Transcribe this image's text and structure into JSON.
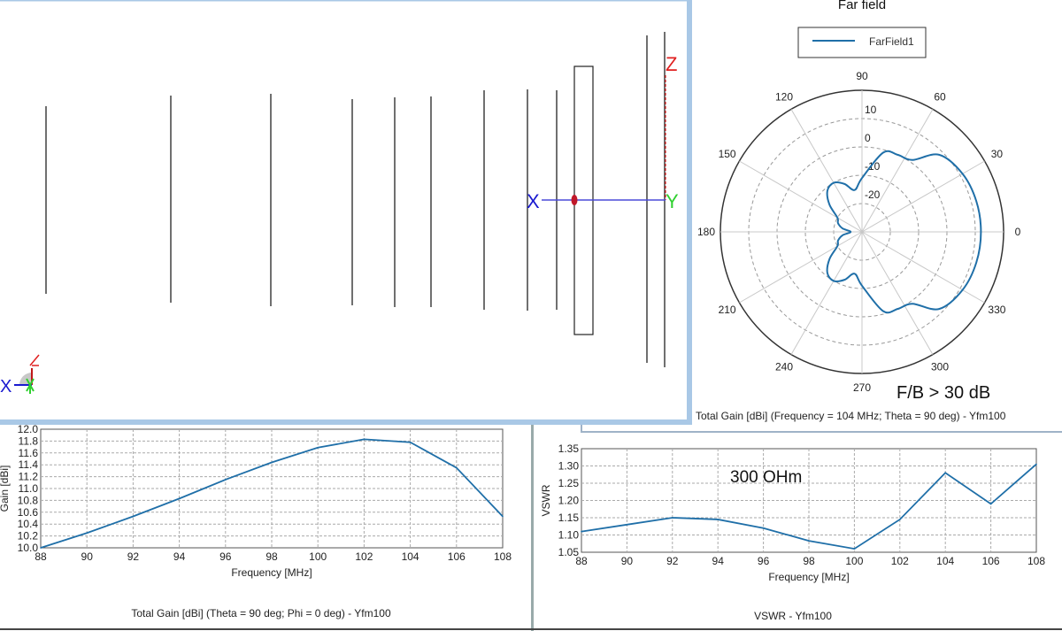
{
  "view3d": {
    "axis_labels": {
      "x": "X",
      "y": "Y",
      "z": "Z"
    },
    "triad_labels": {
      "x": "X"
    }
  },
  "colors": {
    "series": "#1f6fa8",
    "x_axis": "#1a1ad0",
    "y_axis": "#2fd02f",
    "z_axis": "#e02020",
    "grid": "#b0b0b0"
  },
  "farfield": {
    "title": "Far field",
    "legend": "FarField1",
    "annotation": "F/B > 30 dB",
    "caption": "Total Gain [dBi] (Frequency = 104 MHz; Theta = 90 deg) - Yfm100"
  },
  "gain_panel": {
    "caption": "Total Gain [dBi] (Theta = 90 deg; Phi = 0 deg) - Yfm100"
  },
  "vswr_panel": {
    "caption": "VSWR - Yfm100",
    "annotation": "300 OHm"
  },
  "chart_data": [
    {
      "type": "polar",
      "title": "Far field",
      "legend": [
        "FarField1"
      ],
      "angle_ticks": [
        "0",
        "30",
        "60",
        "90",
        "120",
        "150",
        "180",
        "210",
        "240",
        "270",
        "300",
        "330"
      ],
      "radial_ticks": [
        "10",
        "0",
        "-10",
        "-20"
      ],
      "rlim": [
        -30,
        20
      ],
      "series": [
        {
          "name": "FarField1",
          "angles_deg": [
            0,
            15,
            30,
            45,
            55,
            65,
            75,
            90,
            100,
            110,
            120,
            130,
            140,
            150,
            160,
            170,
            180
          ],
          "values_db": [
            12,
            11.8,
            11,
            8.5,
            1,
            0,
            -1,
            -11,
            -15,
            -12,
            -10,
            -11,
            -15,
            -20,
            -21,
            -23,
            -26
          ]
        }
      ]
    },
    {
      "type": "line",
      "title": "",
      "xlabel": "Frequency [MHz]",
      "ylabel": "Gain [dBi]",
      "x": [
        88,
        90,
        92,
        94,
        96,
        98,
        100,
        102,
        104,
        106,
        108
      ],
      "series": [
        {
          "name": "Total Gain",
          "values": [
            10.0,
            10.25,
            10.53,
            10.83,
            11.15,
            11.44,
            11.69,
            11.83,
            11.78,
            11.35,
            10.53
          ]
        }
      ],
      "xlim": [
        88,
        108
      ],
      "ylim": [
        10.0,
        12.0
      ],
      "xticks": [
        "88",
        "90",
        "92",
        "94",
        "96",
        "98",
        "100",
        "102",
        "104",
        "106",
        "108"
      ],
      "yticks": [
        "10.0",
        "10.2",
        "10.4",
        "10.6",
        "10.8",
        "11.0",
        "11.2",
        "11.4",
        "11.6",
        "11.8",
        "12.0"
      ],
      "grid": true
    },
    {
      "type": "line",
      "title": "",
      "xlabel": "Frequency [MHz]",
      "ylabel": "VSWR",
      "x": [
        88,
        90,
        92,
        94,
        96,
        98,
        100,
        102,
        104,
        106,
        108
      ],
      "series": [
        {
          "name": "VSWR",
          "values": [
            1.11,
            1.13,
            1.15,
            1.145,
            1.12,
            1.083,
            1.06,
            1.145,
            1.28,
            1.19,
            1.305
          ]
        }
      ],
      "xlim": [
        88,
        108
      ],
      "ylim": [
        1.05,
        1.35
      ],
      "xticks": [
        "88",
        "90",
        "92",
        "94",
        "96",
        "98",
        "100",
        "102",
        "104",
        "106",
        "108"
      ],
      "yticks": [
        "1.05",
        "1.10",
        "1.15",
        "1.20",
        "1.25",
        "1.30",
        "1.35"
      ],
      "grid": true
    }
  ]
}
